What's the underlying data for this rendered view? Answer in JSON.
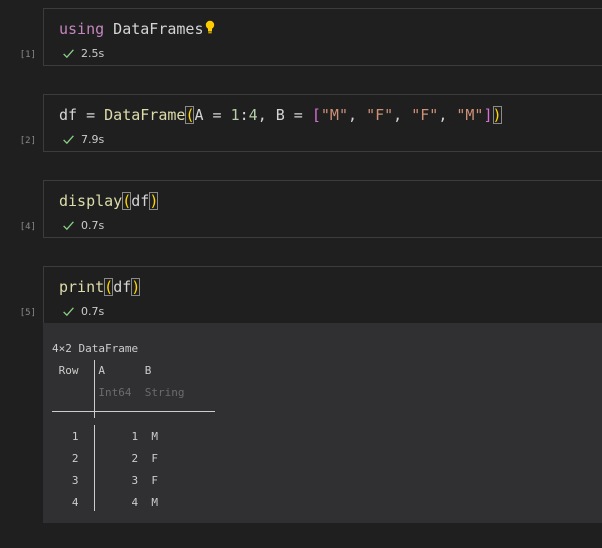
{
  "cells": [
    {
      "exec_count": "[1]",
      "code": {
        "kw": "using",
        "rest": " DataFrames"
      },
      "status": "2.5s"
    },
    {
      "exec_count": "[2]",
      "code": {
        "v1": "df",
        "eq": " = ",
        "fn": "DataFrame",
        "open": "(",
        "a": "A",
        "eq2": " = ",
        "n1": "1",
        "colon": ":",
        "n4": "4",
        "comma": ", ",
        "b": "B",
        "eq3": " = ",
        "lb": "[",
        "s1": "\"M\"",
        "c1": ", ",
        "s2": "\"F\"",
        "c2": ", ",
        "s3": "\"F\"",
        "c3": ", ",
        "s4": "\"M\"",
        "rb": "]",
        "close": ")"
      },
      "status": "7.9s"
    },
    {
      "exec_count": "[4]",
      "code": {
        "fn": "display",
        "open": "(",
        "arg": "df",
        "close": ")"
      },
      "status": "0.7s"
    },
    {
      "exec_count": "[5]",
      "code": {
        "fn": "print",
        "open": "(",
        "arg": "df",
        "close": ")"
      },
      "status": "0.7s"
    }
  ],
  "output": {
    "title": "4×2 DataFrame",
    "header": {
      "row": "Row",
      "a": "A",
      "b": "B"
    },
    "types": {
      "a": "Int64",
      "b": "String"
    },
    "rows": [
      {
        "row": "1",
        "a": "1",
        "b": "M"
      },
      {
        "row": "2",
        "a": "2",
        "b": "F"
      },
      {
        "row": "3",
        "a": "3",
        "b": "F"
      },
      {
        "row": "4",
        "a": "4",
        "b": "M"
      }
    ]
  },
  "colors": {
    "background": "#1f1f1f",
    "keyword": "#c586c0",
    "function": "#dcdcaa",
    "number": "#b5cea8",
    "string": "#ce9178",
    "success": "#89d185",
    "bracket": "#ffd700"
  }
}
